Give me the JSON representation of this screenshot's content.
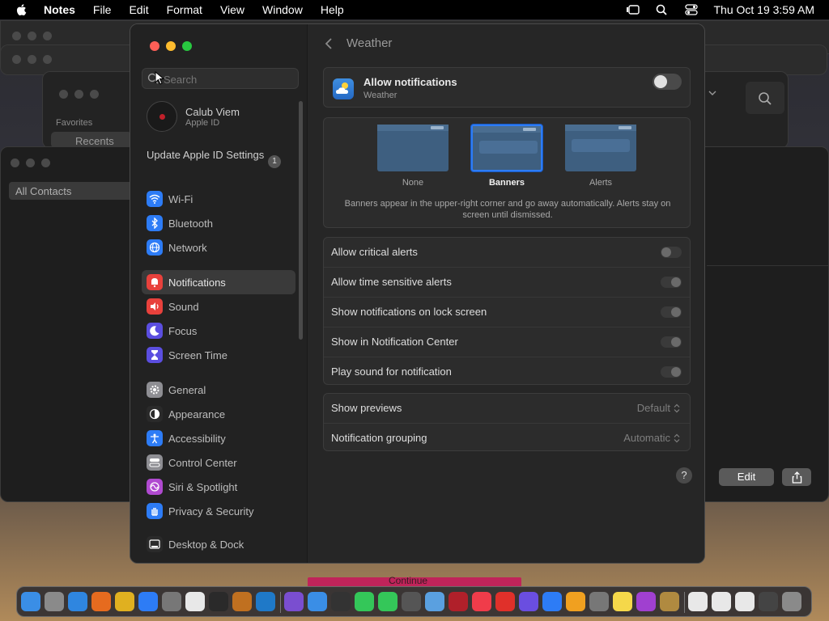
{
  "menubar": {
    "items": [
      "Notes",
      "File",
      "Edit",
      "Format",
      "View",
      "Window",
      "Help"
    ],
    "clock": "Thu Oct 19  3:59 AM"
  },
  "background": {
    "finder_sidebar_heading": "Favorites",
    "finder_sidebar_item": "Recents",
    "contacts_item": "All Contacts",
    "edit_label": "Edit",
    "continue_label": "Continue"
  },
  "sidebar": {
    "search_placeholder": "Search",
    "user_name": "Calub Viem",
    "user_sub": "Apple ID",
    "update_label": "Update Apple ID Settings",
    "update_badge": "1",
    "group1": [
      {
        "label": "Wi-Fi",
        "color": "#2d7cf6"
      },
      {
        "label": "Bluetooth",
        "color": "#2d7cf6"
      },
      {
        "label": "Network",
        "color": "#2d7cf6"
      }
    ],
    "group2": [
      {
        "label": "Notifications",
        "color": "#e8413c",
        "active": true
      },
      {
        "label": "Sound",
        "color": "#e8413c"
      },
      {
        "label": "Focus",
        "color": "#5b4ee0"
      },
      {
        "label": "Screen Time",
        "color": "#5b4ee0"
      }
    ],
    "group3": [
      {
        "label": "General",
        "color": "#8e8e93"
      },
      {
        "label": "Appearance",
        "color": "#2a2a2a"
      },
      {
        "label": "Accessibility",
        "color": "#2d7cf6"
      },
      {
        "label": "Control Center",
        "color": "#8e8e93"
      },
      {
        "label": "Siri & Spotlight",
        "color": "#b04ad0"
      },
      {
        "label": "Privacy & Security",
        "color": "#2d7cf6"
      }
    ],
    "group4": [
      {
        "label": "Desktop & Dock",
        "color": "#2a2a2a"
      }
    ]
  },
  "content": {
    "title": "Weather",
    "allow": {
      "title": "Allow notifications",
      "subtitle": "Weather",
      "enabled": false
    },
    "styles": {
      "options": [
        {
          "label": "None",
          "selected": false
        },
        {
          "label": "Banners",
          "selected": true
        },
        {
          "label": "Alerts",
          "selected": false
        }
      ],
      "description": "Banners appear in the upper-right corner and go away automatically. Alerts stay on screen until dismissed."
    },
    "toggles": [
      {
        "label": "Allow critical alerts",
        "on": false
      },
      {
        "label": "Allow time sensitive alerts",
        "on": true
      },
      {
        "label": "Show notifications on lock screen",
        "on": true
      },
      {
        "label": "Show in Notification Center",
        "on": true
      },
      {
        "label": "Play sound for notification",
        "on": true
      }
    ],
    "selects": [
      {
        "label": "Show previews",
        "value": "Default"
      },
      {
        "label": "Notification grouping",
        "value": "Automatic"
      }
    ],
    "help": "?"
  },
  "dock_apps": [
    {
      "name": "finder",
      "color": "#3a8ee6"
    },
    {
      "name": "launchpad",
      "color": "#8a8a8a"
    },
    {
      "name": "safari",
      "color": "#2f86e0"
    },
    {
      "name": "firefox",
      "color": "#e66b1f"
    },
    {
      "name": "chrome",
      "color": "#e0b020"
    },
    {
      "name": "app-store",
      "color": "#2d7cf6"
    },
    {
      "name": "system-settings",
      "color": "#777"
    },
    {
      "name": "textedit",
      "color": "#e8e8e8"
    },
    {
      "name": "terminal",
      "color": "#2a2a2a"
    },
    {
      "name": "instruments",
      "color": "#c07020"
    },
    {
      "name": "vscode",
      "color": "#1f79c8"
    },
    {
      "name": "visual-studio",
      "color": "#7a4ed0"
    },
    {
      "name": "weather",
      "color": "#3a8ee6"
    },
    {
      "name": "stocks",
      "color": "#333"
    },
    {
      "name": "messages",
      "color": "#34c759"
    },
    {
      "name": "facetime",
      "color": "#34c759"
    },
    {
      "name": "calculator",
      "color": "#555"
    },
    {
      "name": "freeform",
      "color": "#5aa0e0"
    },
    {
      "name": "dictionary",
      "color": "#b0202a"
    },
    {
      "name": "news",
      "color": "#f03c4a"
    },
    {
      "name": "keynote-red",
      "color": "#e0302a"
    },
    {
      "name": "screenshot",
      "color": "#6a4ee0"
    },
    {
      "name": "keynote",
      "color": "#2d7cf6"
    },
    {
      "name": "home",
      "color": "#f0a020"
    },
    {
      "name": "system-info",
      "color": "#777"
    },
    {
      "name": "notes",
      "color": "#f5d84a"
    },
    {
      "name": "podcasts",
      "color": "#a040d0"
    },
    {
      "name": "archive",
      "color": "#b08a40"
    },
    {
      "name": "window-1",
      "color": "#e8e8e8"
    },
    {
      "name": "window-2",
      "color": "#e8e8e8"
    },
    {
      "name": "window-3",
      "color": "#e8e8e8"
    },
    {
      "name": "window-4",
      "color": "#444"
    },
    {
      "name": "trash",
      "color": "#8a8a8a"
    }
  ]
}
